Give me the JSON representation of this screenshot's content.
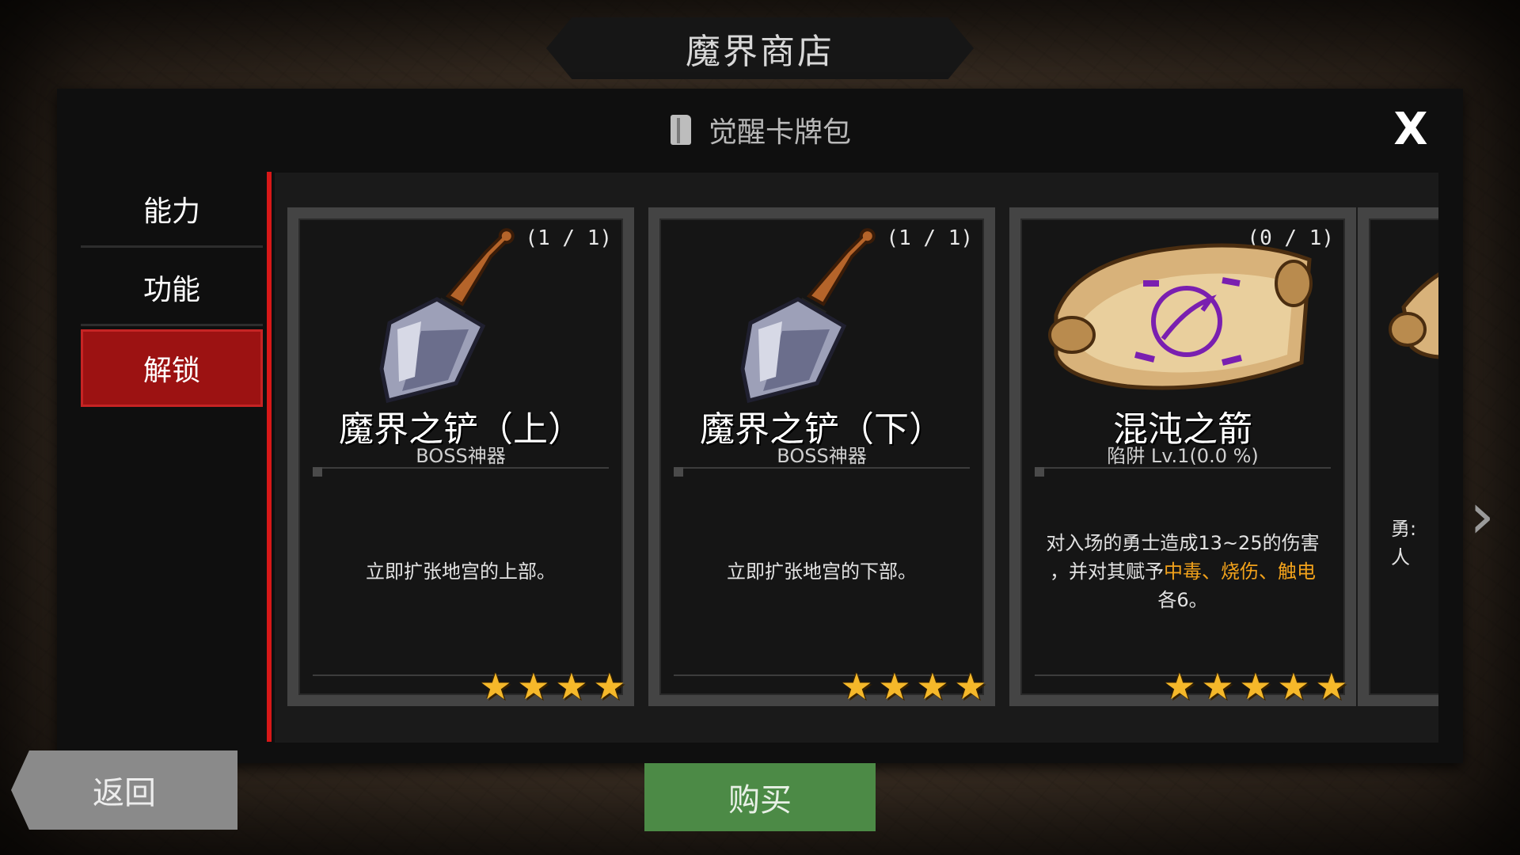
{
  "screen": {
    "title": "魔界商店",
    "subtitle": "觉醒卡牌包",
    "close_label": "X"
  },
  "sidebar": {
    "items": [
      {
        "label": "能力",
        "active": false
      },
      {
        "label": "功能",
        "active": false
      },
      {
        "label": "解锁",
        "active": true
      }
    ]
  },
  "cards": [
    {
      "count": "(1 / 1)",
      "name": "魔界之铲（上）",
      "type": "BOSS神器",
      "description": "立即扩张地宫的上部。",
      "stars": 4,
      "icon": "shovel-icon"
    },
    {
      "count": "(1 / 1)",
      "name": "魔界之铲（下）",
      "type": "BOSS神器",
      "description": "立即扩张地宫的下部。",
      "stars": 4,
      "icon": "shovel-icon"
    },
    {
      "count": "(0 / 1)",
      "name": "混沌之箭",
      "type": "陷阱 Lv.1(0.0 %)",
      "description_parts": {
        "line1": "对入场的勇士造成13~25的伤害",
        "line2_prefix": "，并对其赋予",
        "effect1": "中毒",
        "sep1": "、",
        "effect2": "烧伤",
        "sep2": "、",
        "effect3": "触电",
        "line3": "各6。"
      },
      "stars": 5,
      "icon": "scroll-icon"
    }
  ],
  "partial_card": {
    "text_line1": "勇:",
    "text_line2": "人"
  },
  "buttons": {
    "back": "返回",
    "buy": "购买"
  },
  "colors": {
    "active_tab": "#9c1212",
    "divider": "#d81818",
    "highlight": "#f2a21b",
    "buy": "#4c8a46",
    "star": "#f5b82a"
  }
}
